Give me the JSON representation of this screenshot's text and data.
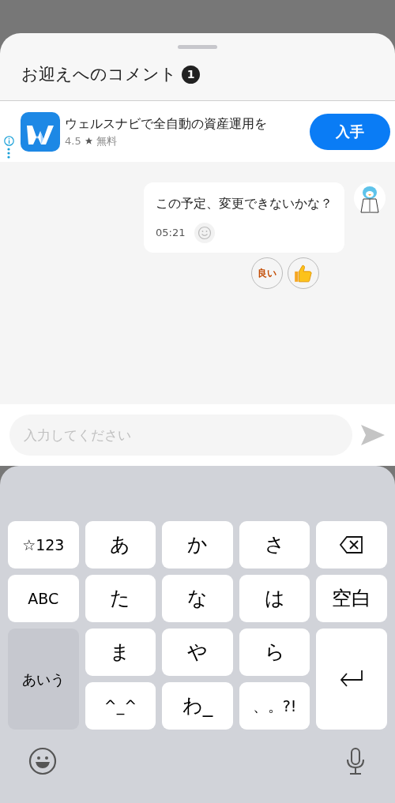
{
  "sheet": {
    "title": "お迎えへのコメント",
    "count": "1"
  },
  "ad": {
    "title": "ウェルスナビで全自動の資産運用を",
    "rating": "4.5",
    "price": "無料",
    "button": "入手"
  },
  "messages": [
    {
      "text": "この予定、変更できないかな？",
      "time": "05:21",
      "reactions": [
        {
          "kind": "sticker",
          "label": "良い"
        },
        {
          "kind": "thumbs-up"
        }
      ]
    }
  ],
  "composer": {
    "placeholder": "入力してください"
  },
  "keyboard": {
    "keys": [
      {
        "kind": "char",
        "label": "☆123"
      },
      {
        "kind": "char",
        "label": "あ"
      },
      {
        "kind": "char",
        "label": "か"
      },
      {
        "kind": "char",
        "label": "さ"
      },
      {
        "kind": "backspace"
      },
      {
        "kind": "char",
        "label": "ABC"
      },
      {
        "kind": "char",
        "label": "た"
      },
      {
        "kind": "char",
        "label": "な"
      },
      {
        "kind": "char",
        "label": "は"
      },
      {
        "kind": "char",
        "label": "空白"
      },
      {
        "kind": "mode",
        "label": "あいう"
      },
      {
        "kind": "char",
        "label": "ま"
      },
      {
        "kind": "char",
        "label": "や"
      },
      {
        "kind": "char",
        "label": "ら"
      },
      {
        "kind": "enter"
      },
      {
        "kind": "char",
        "label": "^_^"
      },
      {
        "kind": "char",
        "label": "わ_"
      },
      {
        "kind": "char",
        "label": "、。?!"
      }
    ]
  }
}
